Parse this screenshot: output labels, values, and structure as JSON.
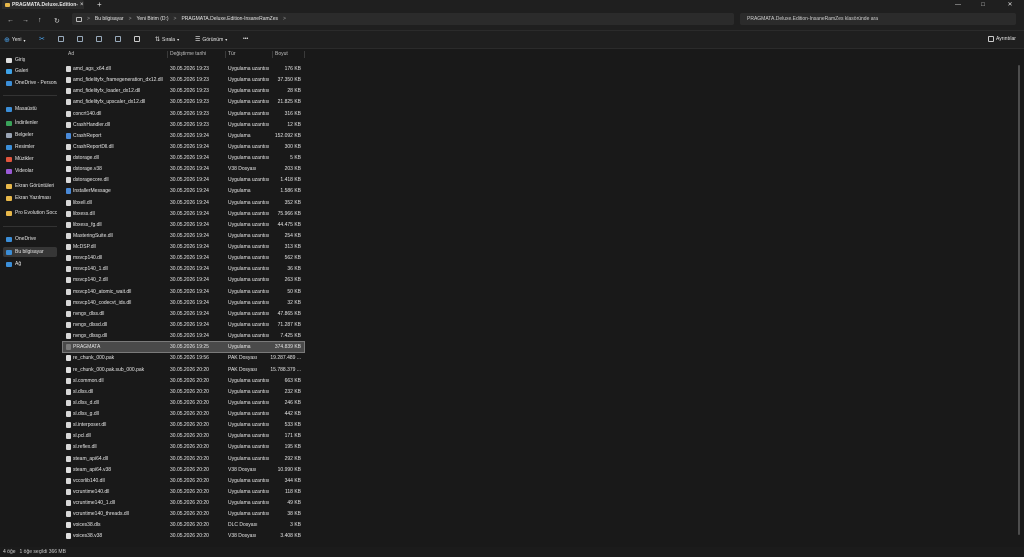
{
  "window": {
    "tab_title": "PRAGMATA.Deluxe.Edition-In",
    "new_tab": "+",
    "close_tab": "×",
    "minimize": "—",
    "maximize": "□",
    "close": "✕"
  },
  "addressbar": {
    "segments": [
      "Bu bilgisayar",
      "Yeni Birim (D:)",
      "PRAGMATA.Deluxe.Edition-InsaneRamZes"
    ],
    "separator": ">",
    "more": ">"
  },
  "search": {
    "placeholder": "PRAGMATA.Deluxe.Edition-InsaneRamZes klasöründe ara"
  },
  "toolbar": {
    "new_label": "Yeni",
    "sort_label": "Sırala",
    "view_label": "Görünüm",
    "more_label": "•••",
    "details_label": "Ayrıntılar"
  },
  "sidebar": {
    "items": [
      {
        "label": "Giriş",
        "color": "#e0e0e0"
      },
      {
        "label": "Galeri",
        "color": "#3fa3e8"
      },
      {
        "label": "OneDrive - Persona",
        "color": "#3b8ed8"
      },
      {
        "label": "Masaüstü",
        "color": "#3b8ed8"
      },
      {
        "label": "İndirilenler",
        "color": "#3aa35a"
      },
      {
        "label": "Belgeler",
        "color": "#9aa5b5"
      },
      {
        "label": "Resimler",
        "color": "#3b8ed8"
      },
      {
        "label": "Müzikler",
        "color": "#e2553d"
      },
      {
        "label": "Videolar",
        "color": "#9b5ad6"
      },
      {
        "label": "Ekran Görüntüleri",
        "color": "#e8b84a"
      },
      {
        "label": "Ekran Yazılması",
        "color": "#e8b84a"
      },
      {
        "label": "Pro Evolution Socc",
        "color": "#e8b84a"
      },
      {
        "label": "OneDrive",
        "color": "#3b8ed8"
      },
      {
        "label": "Bu bilgisayar",
        "color": "#3b8ed8"
      },
      {
        "label": "Ağ",
        "color": "#3b8ed8"
      }
    ]
  },
  "columns": {
    "name": "Ad",
    "date": "Değiştirme tarihi",
    "type": "Tür",
    "size": "Boyut"
  },
  "files": [
    {
      "name": "amd_ags_x64.dll",
      "date": "30.05.2026 19:23",
      "type": "Uygulama uzantısı",
      "size": "176 KB",
      "icon": "dll"
    },
    {
      "name": "amd_fidelityfx_framegeneration_dx12.dll",
      "date": "30.05.2026 19:23",
      "type": "Uygulama uzantısı",
      "size": "37.350 KB",
      "icon": "dll"
    },
    {
      "name": "amd_fidelityfx_loader_dx12.dll",
      "date": "30.05.2026 19:23",
      "type": "Uygulama uzantısı",
      "size": "28 KB",
      "icon": "dll"
    },
    {
      "name": "amd_fidelityfx_upscaler_dx12.dll",
      "date": "30.05.2026 19:23",
      "type": "Uygulama uzantısı",
      "size": "21.825 KB",
      "icon": "dll"
    },
    {
      "name": "concrt140.dll",
      "date": "30.05.2026 19:23",
      "type": "Uygulama uzantısı",
      "size": "316 KB",
      "icon": "dll"
    },
    {
      "name": "CrashHandler.dll",
      "date": "30.05.2026 19:23",
      "type": "Uygulama uzantısı",
      "size": "12 KB",
      "icon": "dll"
    },
    {
      "name": "CrashReport",
      "date": "30.05.2026 19:24",
      "type": "Uygulama",
      "size": "152.092 KB",
      "icon": "exe"
    },
    {
      "name": "CrashReportDll.dll",
      "date": "30.05.2026 19:24",
      "type": "Uygulama uzantısı",
      "size": "300 KB",
      "icon": "dll"
    },
    {
      "name": "dstorage.dll",
      "date": "30.05.2026 19:24",
      "type": "Uygulama uzantısı",
      "size": "5 KB",
      "icon": "dll"
    },
    {
      "name": "dstorage.v38",
      "date": "30.05.2026 19:24",
      "type": "V38 Dosyası",
      "size": "203 KB",
      "icon": "doc"
    },
    {
      "name": "dstoragecore.dll",
      "date": "30.05.2026 19:24",
      "type": "Uygulama uzantısı",
      "size": "1.418 KB",
      "icon": "dll"
    },
    {
      "name": "InstallerMessage",
      "date": "30.05.2026 19:24",
      "type": "Uygulama",
      "size": "1.586 KB",
      "icon": "exe"
    },
    {
      "name": "libxell.dll",
      "date": "30.05.2026 19:24",
      "type": "Uygulama uzantısı",
      "size": "352 KB",
      "icon": "dll"
    },
    {
      "name": "libxess.dll",
      "date": "30.05.2026 19:24",
      "type": "Uygulama uzantısı",
      "size": "75.966 KB",
      "icon": "dll"
    },
    {
      "name": "libxess_fg.dll",
      "date": "30.05.2026 19:24",
      "type": "Uygulama uzantısı",
      "size": "44.475 KB",
      "icon": "dll"
    },
    {
      "name": "MasteringSuite.dll",
      "date": "30.05.2026 19:24",
      "type": "Uygulama uzantısı",
      "size": "254 KB",
      "icon": "dll"
    },
    {
      "name": "McDSP.dll",
      "date": "30.05.2026 19:24",
      "type": "Uygulama uzantısı",
      "size": "313 KB",
      "icon": "dll"
    },
    {
      "name": "msvcp140.dll",
      "date": "30.05.2026 19:24",
      "type": "Uygulama uzantısı",
      "size": "562 KB",
      "icon": "dll"
    },
    {
      "name": "msvcp140_1.dll",
      "date": "30.05.2026 19:24",
      "type": "Uygulama uzantısı",
      "size": "36 KB",
      "icon": "dll"
    },
    {
      "name": "msvcp140_2.dll",
      "date": "30.05.2026 19:24",
      "type": "Uygulama uzantısı",
      "size": "263 KB",
      "icon": "dll"
    },
    {
      "name": "msvcp140_atomic_wait.dll",
      "date": "30.05.2026 19:24",
      "type": "Uygulama uzantısı",
      "size": "50 KB",
      "icon": "dll"
    },
    {
      "name": "msvcp140_codecvt_ids.dll",
      "date": "30.05.2026 19:24",
      "type": "Uygulama uzantısı",
      "size": "32 KB",
      "icon": "dll"
    },
    {
      "name": "nvngx_dlss.dll",
      "date": "30.05.2026 19:24",
      "type": "Uygulama uzantısı",
      "size": "47.865 KB",
      "icon": "dll"
    },
    {
      "name": "nvngx_dlssd.dll",
      "date": "30.05.2026 19:24",
      "type": "Uygulama uzantısı",
      "size": "71.287 KB",
      "icon": "dll"
    },
    {
      "name": "nvngx_dlssg.dll",
      "date": "30.05.2026 19:24",
      "type": "Uygulama uzantısı",
      "size": "7.425 KB",
      "icon": "dll"
    },
    {
      "name": "PRAGMATA",
      "date": "30.05.2026 19:25",
      "type": "Uygulama",
      "size": "374.839 KB",
      "icon": "app",
      "selected": true
    },
    {
      "name": "re_chunk_000.pak",
      "date": "30.05.2026 19:56",
      "type": "PAK Dosyası",
      "size": "19.287.489 ...",
      "icon": "doc"
    },
    {
      "name": "re_chunk_000.pak.sub_000.pak",
      "date": "30.05.2026 20:20",
      "type": "PAK Dosyası",
      "size": "15.788.379 ...",
      "icon": "doc"
    },
    {
      "name": "sl.common.dll",
      "date": "30.05.2026 20:20",
      "type": "Uygulama uzantısı",
      "size": "663 KB",
      "icon": "dll"
    },
    {
      "name": "sl.dlss.dll",
      "date": "30.05.2026 20:20",
      "type": "Uygulama uzantısı",
      "size": "232 KB",
      "icon": "dll"
    },
    {
      "name": "sl.dlss_d.dll",
      "date": "30.05.2026 20:20",
      "type": "Uygulama uzantısı",
      "size": "246 KB",
      "icon": "dll"
    },
    {
      "name": "sl.dlss_g.dll",
      "date": "30.05.2026 20:20",
      "type": "Uygulama uzantısı",
      "size": "442 KB",
      "icon": "dll"
    },
    {
      "name": "sl.interposer.dll",
      "date": "30.05.2026 20:20",
      "type": "Uygulama uzantısı",
      "size": "533 KB",
      "icon": "dll"
    },
    {
      "name": "sl.pcl.dll",
      "date": "30.05.2026 20:20",
      "type": "Uygulama uzantısı",
      "size": "171 KB",
      "icon": "dll"
    },
    {
      "name": "sl.reflex.dll",
      "date": "30.05.2026 20:20",
      "type": "Uygulama uzantısı",
      "size": "195 KB",
      "icon": "dll"
    },
    {
      "name": "steam_api64.dll",
      "date": "30.05.2026 20:20",
      "type": "Uygulama uzantısı",
      "size": "292 KB",
      "icon": "dll"
    },
    {
      "name": "steam_api64.v38",
      "date": "30.05.2026 20:20",
      "type": "V38 Dosyası",
      "size": "10.990 KB",
      "icon": "doc"
    },
    {
      "name": "vccorlib140.dll",
      "date": "30.05.2026 20:20",
      "type": "Uygulama uzantısı",
      "size": "344 KB",
      "icon": "dll"
    },
    {
      "name": "vcruntime140.dll",
      "date": "30.05.2026 20:20",
      "type": "Uygulama uzantısı",
      "size": "118 KB",
      "icon": "dll"
    },
    {
      "name": "vcruntime140_1.dll",
      "date": "30.05.2026 20:20",
      "type": "Uygulama uzantısı",
      "size": "49 KB",
      "icon": "dll"
    },
    {
      "name": "vcruntime140_threads.dll",
      "date": "30.05.2026 20:20",
      "type": "Uygulama uzantısı",
      "size": "38 KB",
      "icon": "dll"
    },
    {
      "name": "voices38.dls",
      "date": "30.05.2026 20:20",
      "type": "DLC Dosyası",
      "size": "3 KB",
      "icon": "doc"
    },
    {
      "name": "voices38.v38",
      "date": "30.05.2026 20:20",
      "type": "V38 Dosyası",
      "size": "3.408 KB",
      "icon": "doc"
    }
  ],
  "status": {
    "count": "4 öğe",
    "selection": "1 öğe seçildi  366 MB"
  }
}
